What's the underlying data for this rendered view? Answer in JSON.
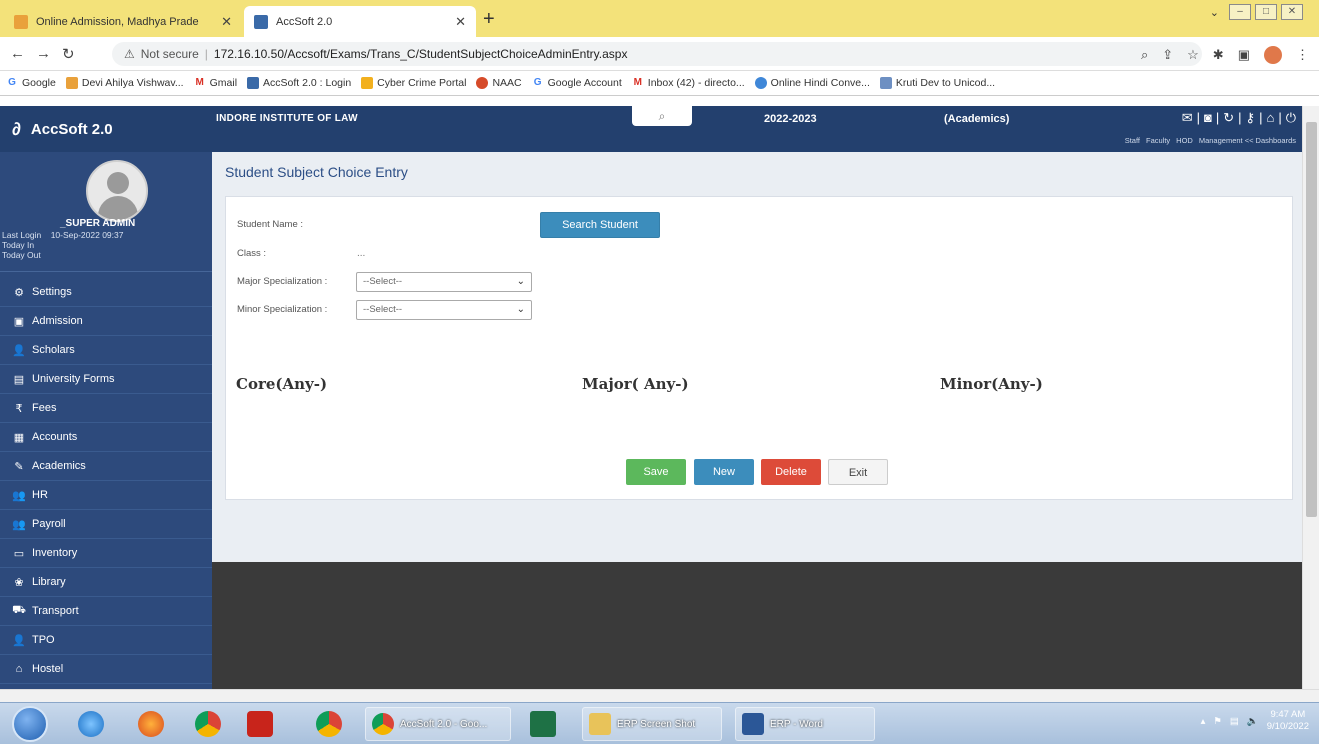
{
  "browser": {
    "tabs": [
      {
        "title": "Online Admission, Madhya Prade",
        "active": false
      },
      {
        "title": "AccSoft 2.0",
        "active": true
      }
    ],
    "new_tab": "+",
    "close_glyph": "✕",
    "address": {
      "security": "Not secure",
      "url": "172.16.10.50/Accsoft/Exams/Trans_C/StudentSubjectChoiceAdminEntry.aspx"
    },
    "bookmarks": [
      "Google",
      "Devi Ahilya Vishwav...",
      "Gmail",
      "AccSoft 2.0 : Login",
      "Cyber Crime Portal",
      "NAAC",
      "Google Account",
      "Inbox (42) - directo...",
      "Online Hindi Conve...",
      "Kruti Dev to Unicod..."
    ]
  },
  "app": {
    "brand": "AccSoft 2.0",
    "institute": "INDORE INSTITUTE OF LAW",
    "session": "2022-2023",
    "module": "(Academics)",
    "top_links": [
      "Staff",
      "Faculty",
      "HOD",
      "Management << Dashboards"
    ],
    "user": {
      "name": "_SUPER ADMIN",
      "last_login_label": "Last Login",
      "last_login_value": "10-Sep-2022 09:37",
      "today_in": "Today In",
      "today_out": "Today Out"
    },
    "menu": [
      {
        "label": "Settings",
        "icon": "gear-icon"
      },
      {
        "label": "Admission",
        "icon": "admission-icon"
      },
      {
        "label": "Scholars",
        "icon": "user-icon"
      },
      {
        "label": "University Forms",
        "icon": "form-icon"
      },
      {
        "label": "Fees",
        "icon": "rupee-icon"
      },
      {
        "label": "Accounts",
        "icon": "accounts-icon"
      },
      {
        "label": "Academics",
        "icon": "pencil-icon"
      },
      {
        "label": "HR",
        "icon": "users-icon"
      },
      {
        "label": "Payroll",
        "icon": "users-icon"
      },
      {
        "label": "Inventory",
        "icon": "inventory-icon"
      },
      {
        "label": "Library",
        "icon": "library-icon"
      },
      {
        "label": "Transport",
        "icon": "car-icon"
      },
      {
        "label": "TPO",
        "icon": "user-icon"
      },
      {
        "label": "Hostel",
        "icon": "home-icon"
      }
    ]
  },
  "page": {
    "title": "Student Subject Choice Entry",
    "form": {
      "student_name_label": "Student Name :",
      "search_button": "Search Student",
      "class_label": "Class :",
      "class_value": "...",
      "major_label": "Major Specialization :",
      "major_value": "--Select--",
      "minor_label": "Minor Specialization :",
      "minor_value": "--Select--"
    },
    "groups": {
      "core": "Core(Any-)",
      "major": "Major( Any-)",
      "minor": "Minor(Any-)"
    },
    "actions": {
      "save": "Save",
      "new": "New",
      "delete": "Delete",
      "exit": "Exit"
    },
    "colors": {
      "save": "#5cb85c",
      "new": "#3c8dbc",
      "delete": "#dd4b39",
      "exit": "#f4f4f4"
    }
  },
  "taskbar": {
    "apps": [
      {
        "label": "AccSoft 2.0 - Goo..."
      },
      {
        "label": "ERP Screen Shot"
      },
      {
        "label": "ERP - Word"
      }
    ],
    "time": "9:47 AM",
    "date": "9/10/2022"
  }
}
